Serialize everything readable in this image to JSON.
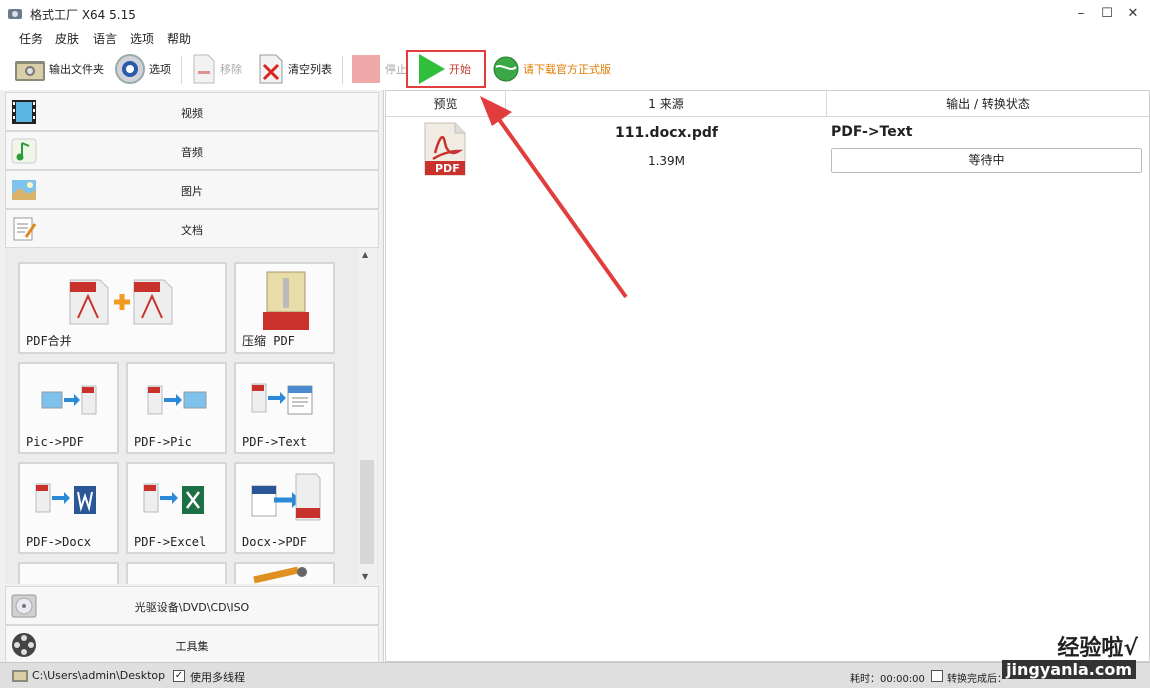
{
  "window": {
    "title": "格式工厂 X64 5.15",
    "minimize": "–",
    "maximize": "☐",
    "close": "✕"
  },
  "menu": [
    "任务",
    "皮肤",
    "语言",
    "选项",
    "帮助"
  ],
  "toolbar": {
    "output_folder": "输出文件夹",
    "options": "选项",
    "remove": "移除",
    "clear_list": "清空列表",
    "stop": "停止",
    "start": "开始",
    "download": "请下载官方正式版"
  },
  "categories": {
    "video": "视频",
    "audio": "音频",
    "picture": "图片",
    "document": "文档",
    "optical": "光驱设备\\DVD\\CD\\ISO",
    "tools": "工具集"
  },
  "tiles": {
    "pdf_merge": "PDF合并",
    "compress_pdf": "压缩 PDF",
    "pic_pdf": "Pic->PDF",
    "pdf_pic": "PDF->Pic",
    "pdf_text": "PDF->Text",
    "pdf_docx": "PDF->Docx",
    "pdf_excel": "PDF->Excel",
    "docx_pdf": "Docx->PDF"
  },
  "table": {
    "headers": {
      "preview": "预览",
      "source": "1 来源",
      "output": "输出 / 转换状态"
    },
    "rows": [
      {
        "preview_label": "PDF",
        "filename": "111.docx.pdf",
        "size": "1.39M",
        "conversion": "PDF->Text",
        "status": "等待中"
      }
    ]
  },
  "statusbar": {
    "path": "C:\\Users\\admin\\Desktop",
    "multithread": "使用多线程",
    "elapsed": "耗时：00:00:00",
    "after_done": "转换完成后："
  },
  "watermark": {
    "text": "经验啦√",
    "url": "jingyanla.com"
  },
  "colors": {
    "accent_red": "#e23d3d",
    "pdf_red": "#c9322c",
    "play_green": "#2fbf3a",
    "download_orange": "#e07a00"
  }
}
